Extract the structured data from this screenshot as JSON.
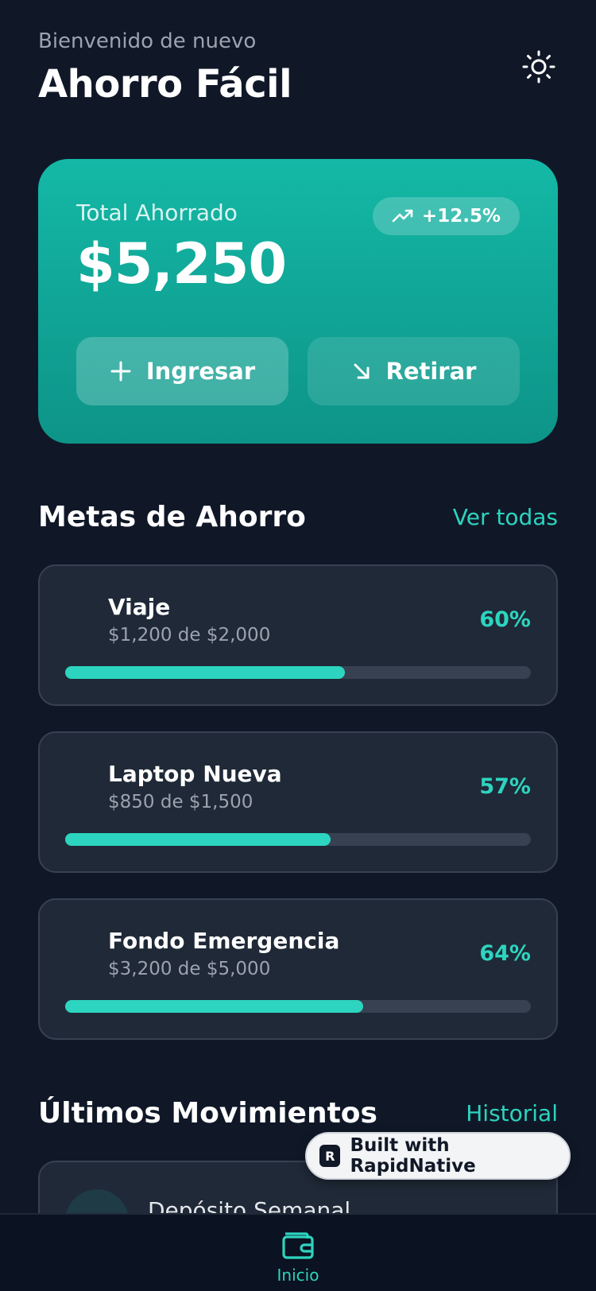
{
  "header": {
    "greeting": "Bienvenido de nuevo",
    "title": "Ahorro Fácil",
    "theme_icon": "sun-icon"
  },
  "balance": {
    "label": "Total Ahorrado",
    "amount": "$5,250",
    "trend": "+12.5%",
    "deposit_label": "Ingresar",
    "withdraw_label": "Retirar"
  },
  "goals_section": {
    "title": "Metas de Ahorro",
    "link": "Ver todas"
  },
  "goals": [
    {
      "name": "Viaje",
      "progress_text": "$1,200 de $2,000",
      "percent_label": "60%",
      "progress": 0.6
    },
    {
      "name": "Laptop Nueva",
      "progress_text": "$850 de $1,500",
      "percent_label": "57%",
      "progress": 0.57
    },
    {
      "name": "Fondo Emergencia",
      "progress_text": "$3,200 de $5,000",
      "percent_label": "64%",
      "progress": 0.64
    }
  ],
  "movements_section": {
    "title": "Últimos Movimientos",
    "link": "Historial"
  },
  "movements": [
    {
      "title": "Depósito Semanal"
    }
  ],
  "badge": {
    "label": "Built with RapidNative"
  },
  "tabbar": {
    "active_label": "Inicio",
    "active_icon": "wallet-icon"
  },
  "colors": {
    "background": "#101828",
    "card": "#1f2937",
    "accent": "#2dd4bf",
    "balance_card_top": "#14b8a6",
    "balance_card_bottom": "#0d9488"
  }
}
